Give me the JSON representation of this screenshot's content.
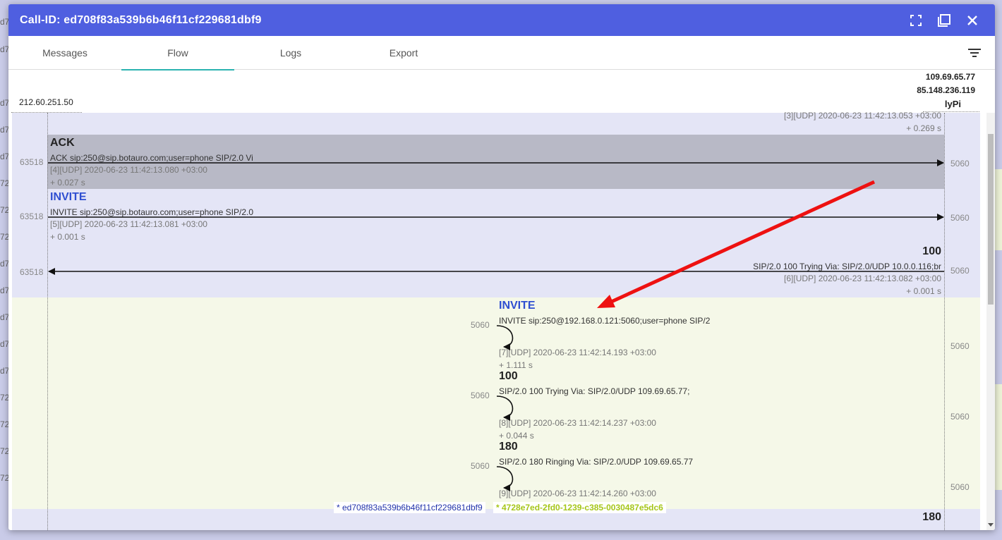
{
  "dialog": {
    "title": "Call-ID: ed708f83a539b6b46f11cf229681dbf9",
    "actions": [
      "fullscreen-icon",
      "restore-icon",
      "close-icon"
    ]
  },
  "tabs": [
    {
      "label": "Messages",
      "active": false
    },
    {
      "label": "Flow",
      "active": true
    },
    {
      "label": "Logs",
      "active": false
    },
    {
      "label": "Export",
      "active": false
    }
  ],
  "background_page": {
    "left_snippets": [
      "d7",
      "d7",
      "d7",
      "d7",
      "d7",
      "72",
      "72",
      "72",
      "d7",
      "d7",
      "d7",
      "d7",
      "d7",
      "72",
      "72",
      "72",
      "72"
    ]
  },
  "hosts": {
    "left": "212.60.251.50",
    "right_ip1": "109.69.65.77",
    "right_ip2": "85.148.236.119",
    "right_name": "lyPi"
  },
  "messages": [
    {
      "meta": "[3][UDP] 2020-06-23 11:42:13.053 +03:00",
      "delta": "+ 0.269 s"
    },
    {
      "name": "ACK",
      "text": "ACK sip:250@sip.botauro.com;user=phone SIP/2.0 Vi",
      "meta": "[4][UDP] 2020-06-23 11:42:13.080 +03:00",
      "delta": "+ 0.027 s",
      "src_port": "63518",
      "dst_port": "5060"
    },
    {
      "name": "INVITE",
      "text": "INVITE sip:250@sip.botauro.com;user=phone SIP/2.0",
      "meta": "[5][UDP] 2020-06-23 11:42:13.081 +03:00",
      "delta": "+ 0.001 s",
      "src_port": "63518",
      "dst_port": "5060"
    },
    {
      "name": "100",
      "text": "SIP/2.0 100 Trying Via: SIP/2.0/UDP 10.0.0.116;br",
      "meta": "[6][UDP] 2020-06-23 11:42:13.082 +03:00",
      "delta": "+ 0.001 s",
      "src_port": "63518",
      "dst_port": "5060"
    },
    {
      "name": "INVITE",
      "text": "INVITE sip:250@192.168.0.121:5060;user=phone SIP/2",
      "meta": "[7][UDP] 2020-06-23 11:42:14.193 +03:00",
      "delta": "+ 1.111 s",
      "port": "5060",
      "right_port": "5060"
    },
    {
      "name": "100",
      "text": "SIP/2.0 100 Trying Via: SIP/2.0/UDP 109.69.65.77;",
      "meta": "[8][UDP] 2020-06-23 11:42:14.237 +03:00",
      "delta": "+ 0.044 s",
      "port": "5060",
      "right_port": "5060"
    },
    {
      "name": "180",
      "text": "SIP/2.0 180 Ringing Via: SIP/2.0/UDP 109.69.65.77",
      "meta": "[9][UDP] 2020-06-23 11:42:14.260 +03:00",
      "port": "5060",
      "right_port": "5060"
    },
    {
      "name": "180"
    }
  ],
  "callids": {
    "primary": "* ed708f83a539b6b46f11cf229681dbf9",
    "secondary": "* 4728e7ed-2fd0-1239-c385-0030487e5dc6"
  },
  "colors": {
    "title_bar": "#4f5fe0",
    "tab_indicator": "#2bb3b0",
    "band_lavender": "#e4e5f6",
    "band_selected": "#b8b9c6",
    "band_green": "#f5f8e8",
    "annotation_arrow": "#ee1111",
    "callid_secondary": "#a6c619"
  }
}
